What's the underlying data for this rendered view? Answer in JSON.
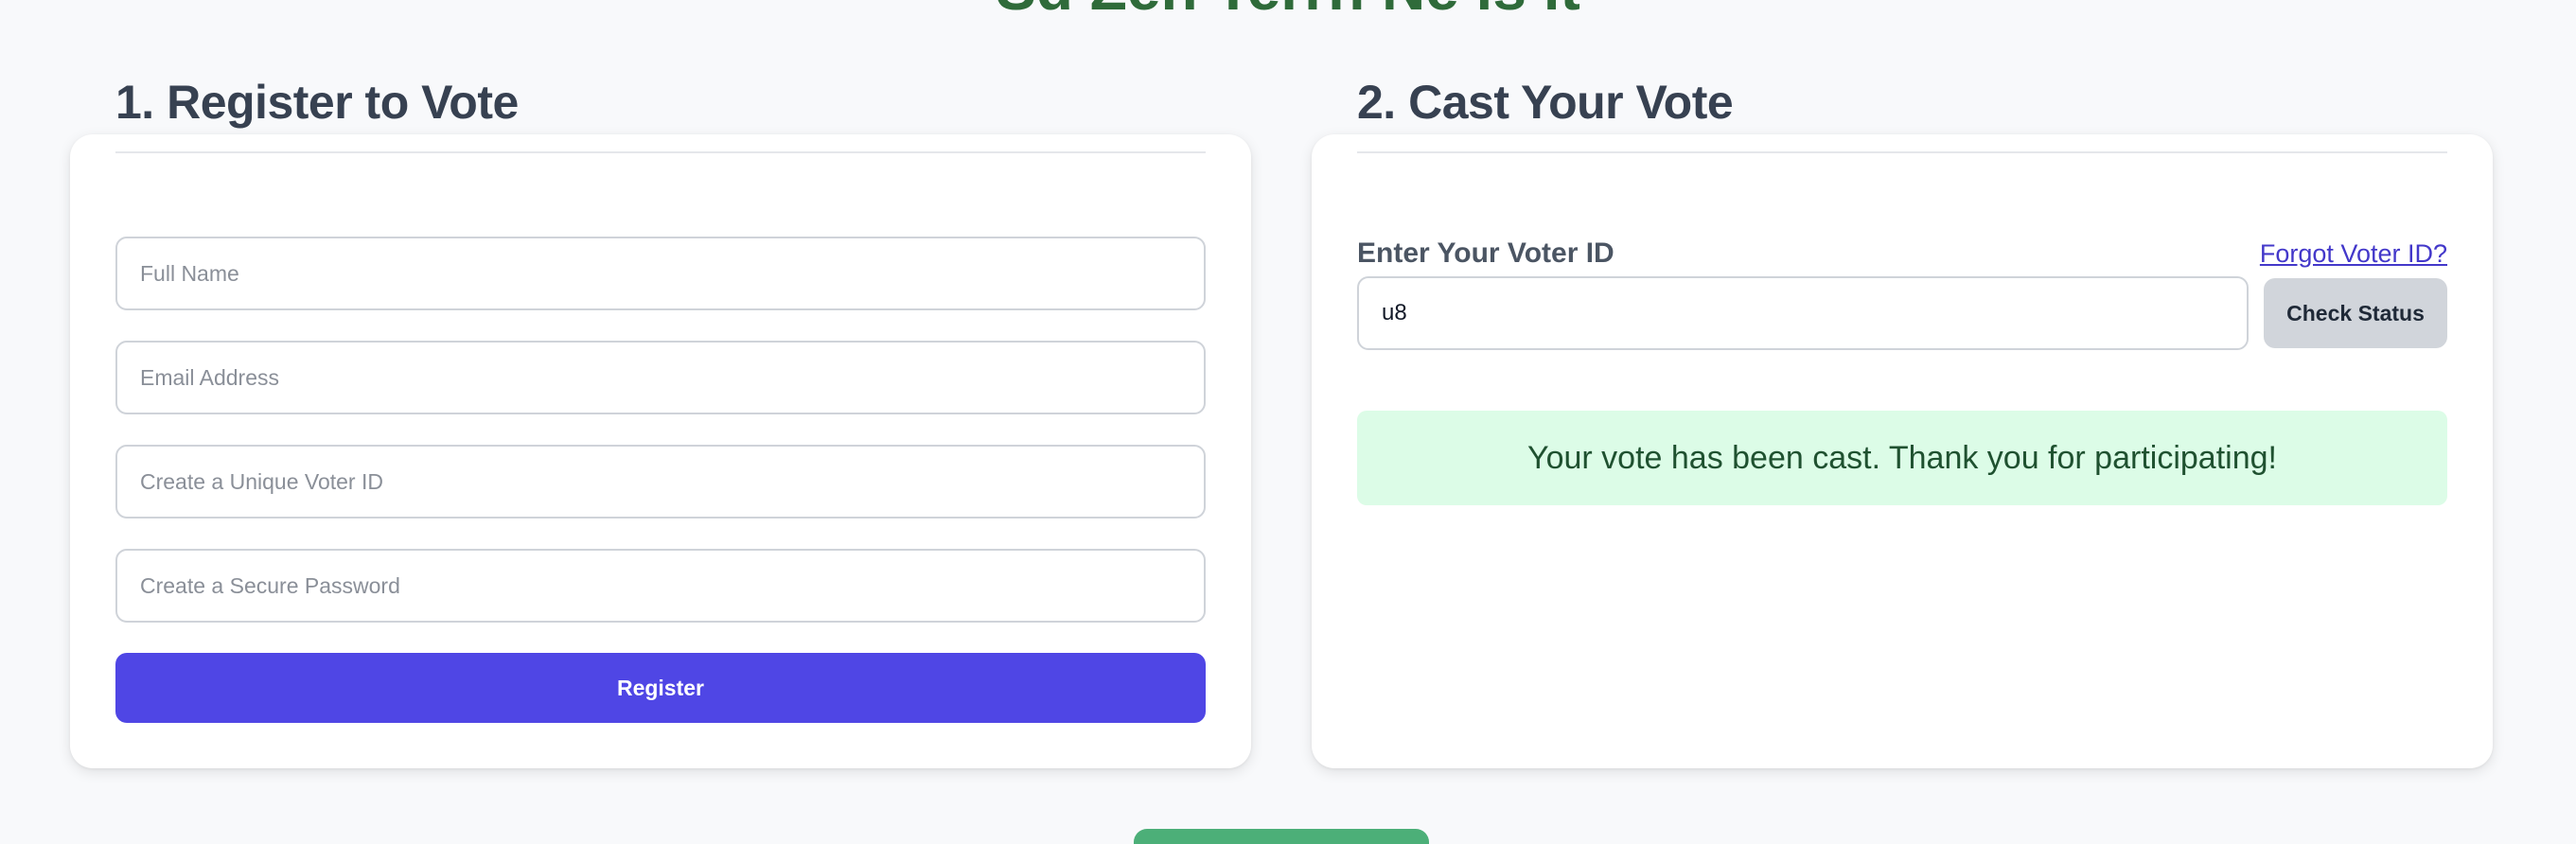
{
  "page": {
    "title": "Sd Zen Terrn Ne ls lt"
  },
  "register": {
    "heading": "1. Register to Vote",
    "full_name_placeholder": "Full Name",
    "email_placeholder": "Email Address",
    "voter_id_placeholder": "Create a Unique Voter ID",
    "password_placeholder": "Create a Secure Password",
    "register_label": "Register"
  },
  "vote": {
    "heading": "2. Cast Your Vote",
    "voter_id_label": "Enter Your Voter ID",
    "forgot_link": "Forgot Voter ID?",
    "voter_id_value": "u8",
    "check_status_label": "Check Status",
    "status_message": "Your vote has been cast. Thank you for participating!"
  },
  "colors": {
    "primary": "#4f46e5",
    "success_bg": "#dcfce7",
    "success_text": "#1f5130",
    "title_green": "#2f6b3a",
    "bottom_button": "#4caf78"
  }
}
